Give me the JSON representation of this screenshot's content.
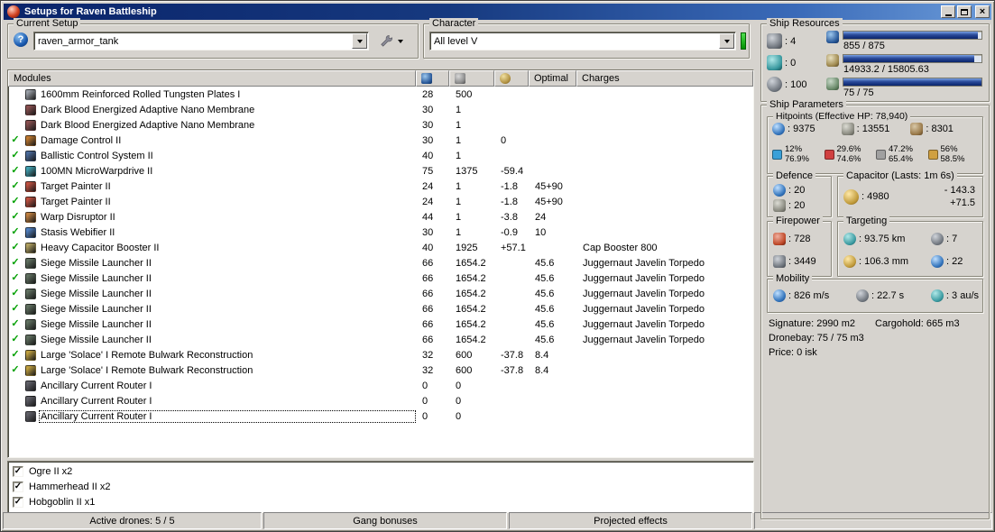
{
  "window": {
    "title": "Setups for Raven Battleship"
  },
  "setup": {
    "group_label": "Current Setup",
    "dropdown_value": "raven_armor_tank"
  },
  "character": {
    "group_label": "Character",
    "dropdown_value": "All level V"
  },
  "modules_table": {
    "header": {
      "modules": "Modules",
      "optimal": "Optimal",
      "charges": "Charges"
    },
    "rows": [
      {
        "checked": false,
        "icon_color": "#9aa0a8",
        "name": "1600mm Reinforced Rolled Tungsten Plates I",
        "cpu": "28",
        "pg": "500",
        "cap": "",
        "optimal": "",
        "charges": ""
      },
      {
        "checked": false,
        "icon_color": "#8a5050",
        "name": "Dark Blood Energized Adaptive Nano Membrane",
        "cpu": "30",
        "pg": "1",
        "cap": "",
        "optimal": "",
        "charges": ""
      },
      {
        "checked": false,
        "icon_color": "#8a5050",
        "name": "Dark Blood Energized Adaptive Nano Membrane",
        "cpu": "30",
        "pg": "1",
        "cap": "",
        "optimal": "",
        "charges": ""
      },
      {
        "checked": true,
        "icon_color": "#c07a30",
        "name": "Damage Control II",
        "cpu": "30",
        "pg": "1",
        "cap": "0",
        "optimal": "",
        "charges": ""
      },
      {
        "checked": true,
        "icon_color": "#4a6a9a",
        "name": "Ballistic Control System II",
        "cpu": "40",
        "pg": "1",
        "cap": "",
        "optimal": "",
        "charges": ""
      },
      {
        "checked": true,
        "icon_color": "#40a0b0",
        "name": "100MN MicroWarpdrive II",
        "cpu": "75",
        "pg": "1375",
        "cap": "-59.4",
        "optimal": "",
        "charges": ""
      },
      {
        "checked": true,
        "icon_color": "#c05040",
        "name": "Target Painter II",
        "cpu": "24",
        "pg": "1",
        "cap": "-1.8",
        "optimal": "45+90",
        "charges": ""
      },
      {
        "checked": true,
        "icon_color": "#c05040",
        "name": "Target Painter II",
        "cpu": "24",
        "pg": "1",
        "cap": "-1.8",
        "optimal": "45+90",
        "charges": ""
      },
      {
        "checked": true,
        "icon_color": "#c08040",
        "name": "Warp Disruptor II",
        "cpu": "44",
        "pg": "1",
        "cap": "-3.8",
        "optimal": "24",
        "charges": ""
      },
      {
        "checked": true,
        "icon_color": "#5080c0",
        "name": "Stasis Webifier II",
        "cpu": "30",
        "pg": "1",
        "cap": "-0.9",
        "optimal": "10",
        "charges": ""
      },
      {
        "checked": true,
        "icon_color": "#b0a060",
        "name": "Heavy Capacitor Booster II",
        "cpu": "40",
        "pg": "1925",
        "cap": "+57.1",
        "optimal": "",
        "charges": "Cap Booster 800"
      },
      {
        "checked": true,
        "icon_color": "#607060",
        "name": "Siege Missile Launcher II",
        "cpu": "66",
        "pg": "1654.2",
        "cap": "",
        "optimal": "45.6",
        "charges": "Juggernaut Javelin Torpedo"
      },
      {
        "checked": true,
        "icon_color": "#607060",
        "name": "Siege Missile Launcher II",
        "cpu": "66",
        "pg": "1654.2",
        "cap": "",
        "optimal": "45.6",
        "charges": "Juggernaut Javelin Torpedo"
      },
      {
        "checked": true,
        "icon_color": "#607060",
        "name": "Siege Missile Launcher II",
        "cpu": "66",
        "pg": "1654.2",
        "cap": "",
        "optimal": "45.6",
        "charges": "Juggernaut Javelin Torpedo"
      },
      {
        "checked": true,
        "icon_color": "#607060",
        "name": "Siege Missile Launcher II",
        "cpu": "66",
        "pg": "1654.2",
        "cap": "",
        "optimal": "45.6",
        "charges": "Juggernaut Javelin Torpedo"
      },
      {
        "checked": true,
        "icon_color": "#607060",
        "name": "Siege Missile Launcher II",
        "cpu": "66",
        "pg": "1654.2",
        "cap": "",
        "optimal": "45.6",
        "charges": "Juggernaut Javelin Torpedo"
      },
      {
        "checked": true,
        "icon_color": "#607060",
        "name": "Siege Missile Launcher II",
        "cpu": "66",
        "pg": "1654.2",
        "cap": "",
        "optimal": "45.6",
        "charges": "Juggernaut Javelin Torpedo"
      },
      {
        "checked": true,
        "icon_color": "#c0a040",
        "name": "Large 'Solace' I Remote Bulwark Reconstruction",
        "cpu": "32",
        "pg": "600",
        "cap": "-37.8",
        "optimal": "8.4",
        "charges": ""
      },
      {
        "checked": true,
        "icon_color": "#c0a040",
        "name": "Large 'Solace' I Remote Bulwark Reconstruction",
        "cpu": "32",
        "pg": "600",
        "cap": "-37.8",
        "optimal": "8.4",
        "charges": ""
      },
      {
        "checked": false,
        "icon_color": "#606068",
        "name": "Ancillary Current Router I",
        "cpu": "0",
        "pg": "0",
        "cap": "",
        "optimal": "",
        "charges": ""
      },
      {
        "checked": false,
        "icon_color": "#606068",
        "name": "Ancillary Current Router I",
        "cpu": "0",
        "pg": "0",
        "cap": "",
        "optimal": "",
        "charges": ""
      },
      {
        "checked": false,
        "icon_color": "#606068",
        "name": "Ancillary Current Router I",
        "cpu": "0",
        "pg": "0",
        "cap": "",
        "optimal": "",
        "charges": "",
        "selected": true
      }
    ]
  },
  "drones": {
    "items": [
      {
        "checked": true,
        "label": "Ogre II x2"
      },
      {
        "checked": true,
        "label": "Hammerhead II x2"
      },
      {
        "checked": true,
        "label": "Hobgoblin II x1"
      }
    ]
  },
  "status_bar": {
    "active_drones": "Active drones: 5 / 5",
    "gang_bonuses": "Gang bonuses",
    "projected_effects": "Projected effects"
  },
  "ship_resources": {
    "title": "Ship Resources",
    "turrets": ": 4",
    "launchers": ": 0",
    "calibration": ": 100",
    "cpu": {
      "text": "855 / 875",
      "pct": 97.7
    },
    "powergrid": {
      "text": "14933.2 / 15805.63",
      "pct": 94.5
    },
    "dronebay": {
      "text": "75 / 75",
      "pct": 100
    }
  },
  "ship_parameters": {
    "title": "Ship Parameters",
    "hitpoints": {
      "title": "Hitpoints (Effective HP: 78,940)",
      "shield": ": 9375",
      "armor": ": 13551",
      "structure": ": 8301",
      "resists": [
        {
          "shield": "12%",
          "armor": "76.9%",
          "color": "#3aa0d8"
        },
        {
          "shield": "29.6%",
          "armor": "74.6%",
          "color": "#d04040"
        },
        {
          "shield": "47.2%",
          "armor": "65.4%",
          "color": "#a0a0a0"
        },
        {
          "shield": "56%",
          "armor": "58.5%",
          "color": "#d0a040"
        }
      ]
    },
    "defence": {
      "title": "Defence",
      "value1": ": 20",
      "value2": ": 20"
    },
    "capacitor": {
      "title": "Capacitor (Lasts: 1m 6s)",
      "amount": ": 4980",
      "drain": "- 143.3",
      "peak": "+71.5"
    },
    "firepower": {
      "title": "Firepower",
      "volley": ": 728",
      "dps": ": 3449"
    },
    "targeting": {
      "title": "Targeting",
      "range": ": 93.75 km",
      "max_targets": ": 7",
      "scan_resolution": ": 106.3 mm",
      "sensor_strength": ": 22"
    },
    "mobility": {
      "title": "Mobility",
      "speed": ": 826 m/s",
      "align_time": ": 22.7 s",
      "warp_speed": ": 3 au/s"
    },
    "info": {
      "signature": "Signature: 2990 m2",
      "cargohold": "Cargohold: 665 m3",
      "dronebay": "Dronebay: 75 / 75 m3",
      "price": "Price: 0 isk"
    }
  }
}
